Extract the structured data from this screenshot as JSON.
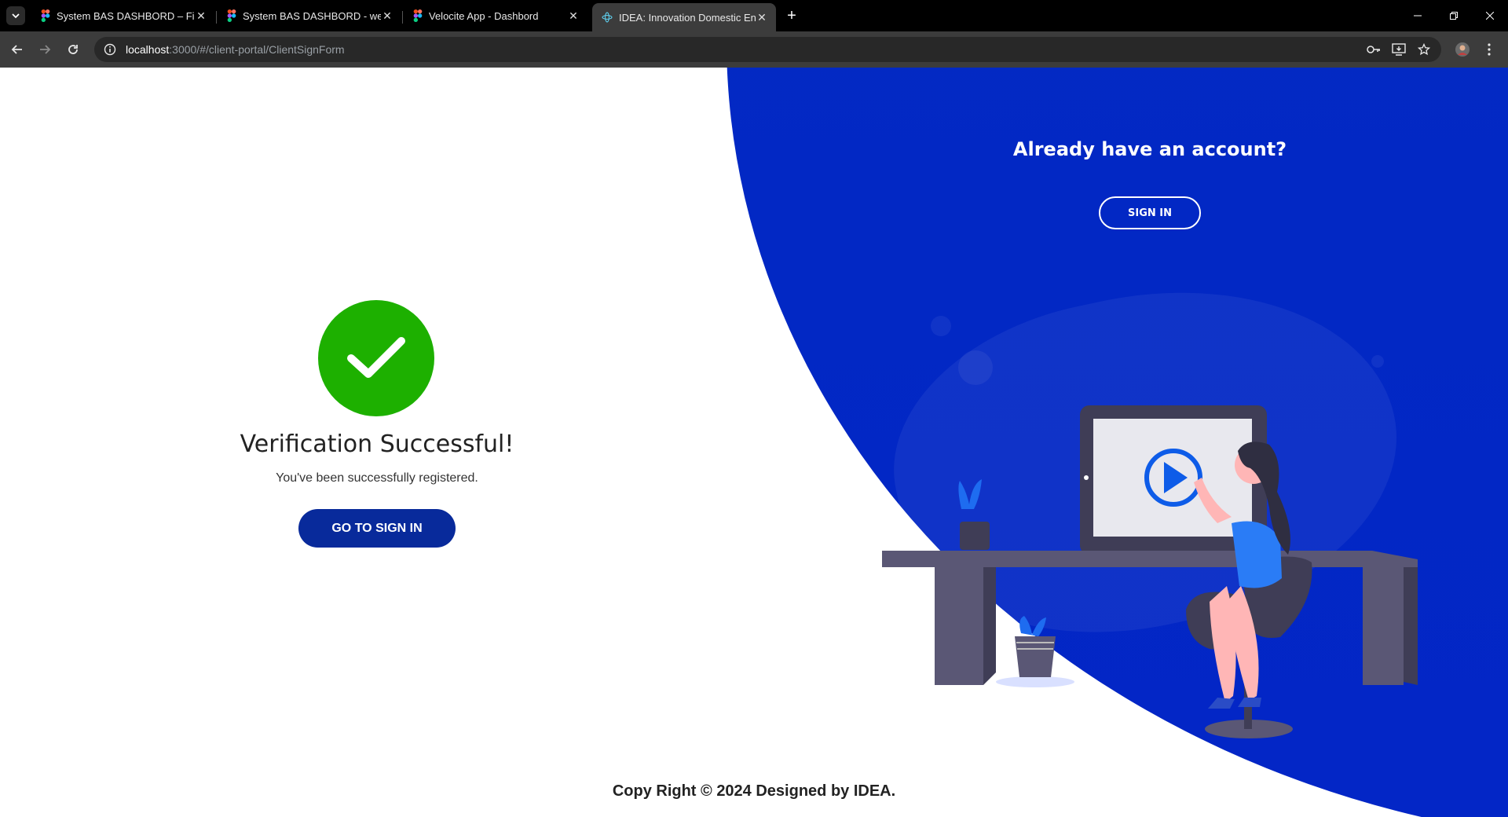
{
  "browser": {
    "tabs": [
      {
        "title": "System BAS DASHBORD – Figma",
        "favicon": "figma-icon",
        "active": false
      },
      {
        "title": "System BAS DASHBORD - web",
        "favicon": "figma-icon",
        "active": false
      },
      {
        "title": "Velocite App - Dashbord",
        "favicon": "figma-icon",
        "active": false
      },
      {
        "title": "IDEA: Innovation Domestic Entr",
        "favicon": "react-icon",
        "active": true
      }
    ],
    "url_host": "localhost",
    "url_rest": ":3000/#/client-portal/ClientSignForm"
  },
  "right_panel": {
    "title": "Already have an account?",
    "signin_label": "SIGN IN"
  },
  "main": {
    "headline": "Verification Successful!",
    "subtext": "You've been successfully registered.",
    "goto_label": "GO TO SIGN IN"
  },
  "footer": {
    "copyright": "Copy Right © 2024 Designed by IDEA."
  },
  "colors": {
    "accent_blue": "#0228c4",
    "button_blue": "#082a9b",
    "success_green": "#1db000"
  }
}
